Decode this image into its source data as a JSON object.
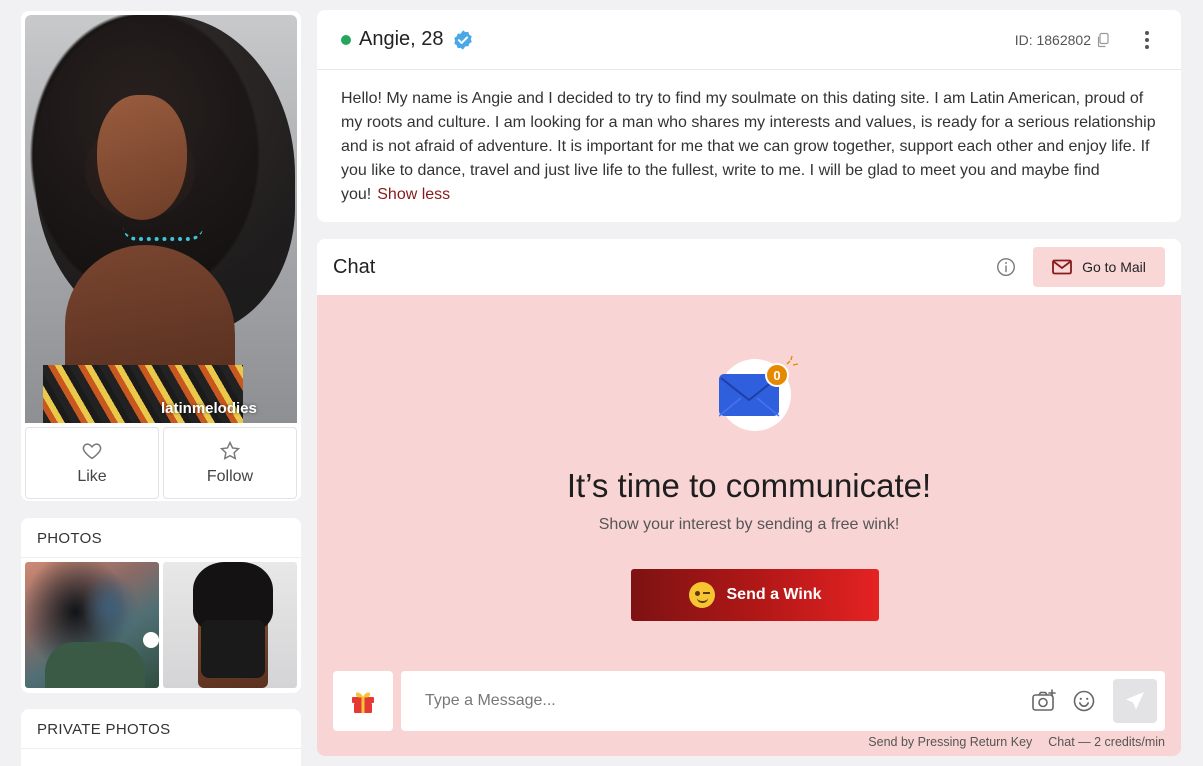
{
  "profile": {
    "watermark": "latinmelodies",
    "like_label": "Like",
    "follow_label": "Follow"
  },
  "photos": {
    "title": "PHOTOS"
  },
  "private_photos": {
    "title": "PRIVATE PHOTOS"
  },
  "header": {
    "name": "Angie, 28",
    "status": "online",
    "id_label": "ID: 1862802"
  },
  "bio": {
    "text": "Hello! My name is Angie and I decided to try to find my soulmate on this dating site. I am Latin American, proud of my roots and culture. I am looking for a man who shares my interests and values, is ready for a serious relationship and is not afraid of adventure. It is important for me that we can grow together, support each other and enjoy life. If you like to dance, travel and just live life to the fullest, write to me. I will be glad to meet you and maybe find you!",
    "toggle_label": "Show less"
  },
  "chat": {
    "title": "Chat",
    "mail_button": "Go to Mail",
    "badge_count": "0",
    "headline": "It’s time to communicate!",
    "subline": "Show your interest by sending a free wink!",
    "wink_button": "Send a Wink",
    "input_placeholder": "Type a Message...",
    "send_hint": "Send by Pressing Return Key",
    "price_note": "Chat — 2 credits/min"
  },
  "colors": {
    "accent": "#8a1a1a",
    "online": "#26a65b",
    "verified": "#4aa8e8",
    "chat_bg": "#f9d4d4"
  }
}
